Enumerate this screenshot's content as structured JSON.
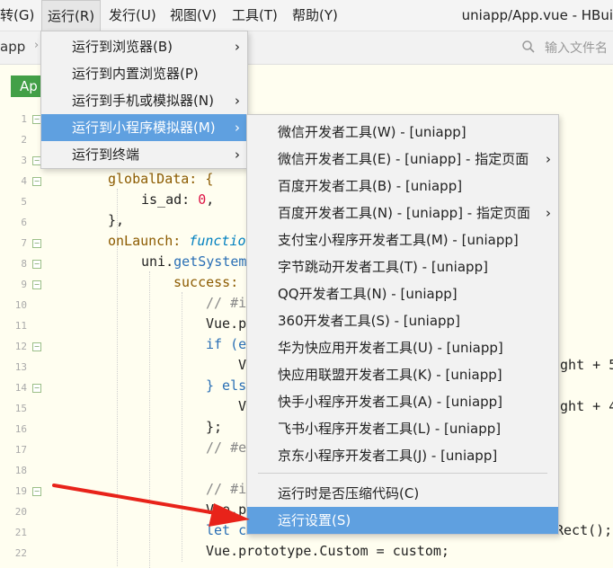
{
  "menubar": {
    "items": [
      {
        "label": "转(G)",
        "x_hint": "cut"
      },
      {
        "label": "运行(R)"
      },
      {
        "label": "发行(U)"
      },
      {
        "label": "视图(V)"
      },
      {
        "label": "工具(T)"
      },
      {
        "label": "帮助(Y)"
      }
    ],
    "title": "uniapp/App.vue - HBui"
  },
  "tabbar": {
    "crumb": "app",
    "search_placeholder": "输入文件名"
  },
  "editor": {
    "file_tab": "Ap",
    "line_numbers": [
      "1",
      "2",
      "3",
      "4",
      "5",
      "6",
      "7",
      "8",
      "9",
      "10",
      "11",
      "12",
      "13",
      "14",
      "15",
      "16",
      "17",
      "18",
      "19",
      "20",
      "21",
      "22"
    ],
    "code": {
      "l4": "globalData: {",
      "l5a": "is_ad: ",
      "l5b": "0",
      "l5c": ",",
      "l6": "},",
      "l7a": "onLaunch: ",
      "l7b": "functio",
      "l8a": "uni.",
      "l8b": "getSystem",
      "l9": "success:",
      "l10": "// #i",
      "l11": "Vue.p",
      "l11r": ";",
      "l12": "if (e",
      "l13": "V",
      "l13r": "ight + 5",
      "l14": "} els",
      "l15": "V",
      "l15r": "ight + 4",
      "l16": "};",
      "l17": "// #e",
      "l19": "// #i",
      "l20": "Vue.p",
      "l20r": ";",
      "l21": "let c",
      "l21r": "Rect();",
      "l22": "Vue.prototype.Custom = custom;"
    }
  },
  "run_menu": {
    "items": [
      {
        "label": "运行到浏览器(B)",
        "has_submenu": true
      },
      {
        "label": "运行到内置浏览器(P)",
        "has_submenu": false
      },
      {
        "label": "运行到手机或模拟器(N)",
        "has_submenu": true
      },
      {
        "label": "运行到小程序模拟器(M)",
        "has_submenu": true,
        "selected": true
      },
      {
        "label": "运行到终端",
        "has_submenu": true
      }
    ]
  },
  "miniprogram_menu": {
    "items": [
      {
        "label": "微信开发者工具(W) - [uniapp]",
        "has_submenu": false
      },
      {
        "label": "微信开发者工具(E) - [uniapp] - 指定页面",
        "has_submenu": true
      },
      {
        "label": "百度开发者工具(B) - [uniapp]",
        "has_submenu": false
      },
      {
        "label": "百度开发者工具(N) - [uniapp] - 指定页面",
        "has_submenu": true
      },
      {
        "label": "支付宝小程序开发者工具(M) - [uniapp]",
        "has_submenu": false
      },
      {
        "label": "字节跳动开发者工具(T) - [uniapp]",
        "has_submenu": false
      },
      {
        "label": "QQ开发者工具(N) - [uniapp]",
        "has_submenu": false
      },
      {
        "label": "360开发者工具(S) - [uniapp]",
        "has_submenu": false
      },
      {
        "label": "华为快应用开发者工具(U) - [uniapp]",
        "has_submenu": false
      },
      {
        "label": "快应用联盟开发者工具(K) - [uniapp]",
        "has_submenu": false
      },
      {
        "label": "快手小程序开发者工具(A) - [uniapp]",
        "has_submenu": false
      },
      {
        "label": "飞书小程序开发者工具(L) - [uniapp]",
        "has_submenu": false
      },
      {
        "label": "京东小程序开发者工具(J) - [uniapp]",
        "has_submenu": false
      }
    ],
    "extra_items": [
      {
        "label": "运行时是否压缩代码(C)"
      },
      {
        "label": "运行设置(S)",
        "selected": true
      }
    ]
  },
  "colors": {
    "selection": "#5fa0e0",
    "annotation_arrow": "#e8231a",
    "file_tab": "#43a047"
  }
}
